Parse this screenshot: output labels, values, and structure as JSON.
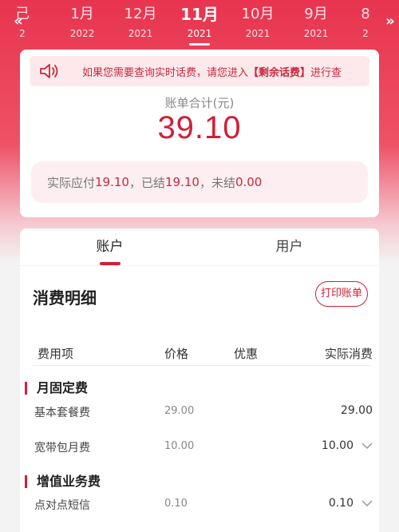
{
  "month_nav": {
    "prev_icon": "double-chevron-left-icon",
    "next_icon": "double-chevron-right-icon",
    "left_partial": {
      "m": "己",
      "y": "2"
    },
    "months": [
      {
        "m": "1月",
        "y": "2022"
      },
      {
        "m": "12月",
        "y": "2021"
      },
      {
        "m": "11月",
        "y": "2021"
      },
      {
        "m": "10月",
        "y": "2021"
      },
      {
        "m": "9月",
        "y": "2021"
      }
    ],
    "right_partial": {
      "m": "8",
      "y": "2"
    },
    "active_index": 2
  },
  "summary": {
    "notice_icon": "speaker-icon",
    "notice_before": "如果您需要查询实时话费，请您进入",
    "notice_link": "【剩余话费】",
    "notice_after": "进行查",
    "total_label": "账单合计(元)",
    "total_amount": "39.10",
    "due_label": "实际应付",
    "due_value": "19.10",
    "settled_label": "，已结",
    "settled_value": "19.10",
    "unsettled_label": "，未结",
    "unsettled_value": "0.00"
  },
  "tabs": [
    {
      "label": "账户",
      "active": true
    },
    {
      "label": "用户",
      "active": false
    }
  ],
  "detail": {
    "title": "消费明细",
    "print_label": "打印账单",
    "columns": [
      "费用项",
      "价格",
      "优惠",
      "实际消费"
    ],
    "groups": [
      {
        "name": "月固定费"
      },
      {
        "name": "增值业务费"
      }
    ],
    "rows": [
      {
        "name": "基本套餐费",
        "price": "29.00",
        "actual": "29.00",
        "expandable": false
      },
      {
        "name": "宽带包月费",
        "price": "10.00",
        "actual": "10.00",
        "expandable": true
      },
      {
        "name": "点对点短信",
        "price": "0.10",
        "actual": "0.10",
        "expandable": true
      }
    ]
  },
  "colors": {
    "brand_red": "#d31e35",
    "header_red": "#e8344f",
    "notice_bg": "#fde9eb"
  }
}
